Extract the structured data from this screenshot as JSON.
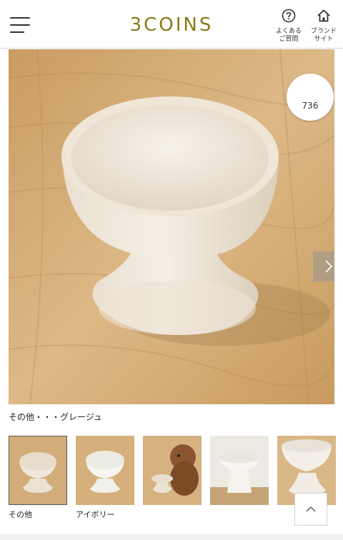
{
  "header": {
    "logo": "3COINS",
    "faq_label": "よくある\n ご質問",
    "brand_label": "ブランド\nサイト"
  },
  "product_image": {
    "view_count": "736",
    "caption": "その他・・・グレージュ"
  },
  "thumbnails": [
    {
      "label": "その他",
      "selected": true
    },
    {
      "label": "アイボリー",
      "selected": false
    },
    {
      "label": "",
      "selected": false
    },
    {
      "label": "",
      "selected": false
    },
    {
      "label": "",
      "selected": false
    }
  ],
  "colors": {
    "logo": "#8a7a16",
    "wood": "#d7b27f",
    "bowl": "#f0e9de"
  },
  "icons": [
    "menu-icon",
    "question-circle-icon",
    "home-icon",
    "chevron-right-icon",
    "chevron-up-icon"
  ]
}
